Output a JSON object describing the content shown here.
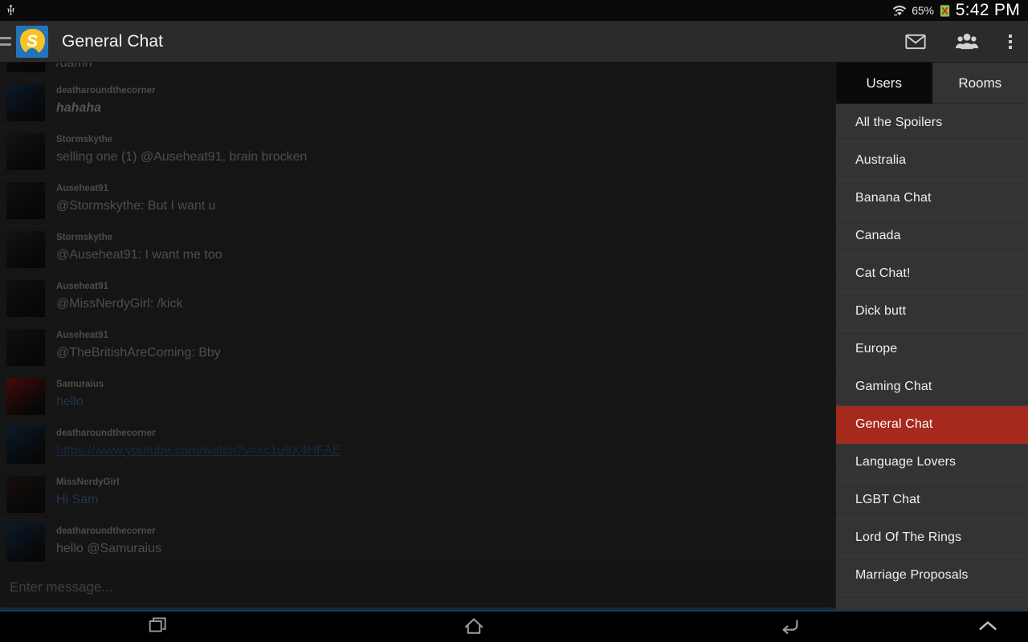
{
  "status_bar": {
    "usb_icon": "usb-icon",
    "wifi_icon": "wifi-icon",
    "battery_percent": "65%",
    "battery_icon": "battery-charging-icon",
    "time": "5:42 PM"
  },
  "action_bar": {
    "menu_icon": "hamburger-icon",
    "app_logo": "app-logo-s",
    "logo_letter": "S",
    "title": "General Chat",
    "actions": [
      {
        "name": "mail-icon",
        "label": "Mail"
      },
      {
        "name": "people-icon",
        "label": "Users"
      },
      {
        "name": "overflow-menu-icon",
        "label": "More options"
      }
    ]
  },
  "chat": {
    "messages": [
      {
        "user": "",
        "text": "/damn",
        "style": "plain",
        "clipped": true,
        "avatar": "#1c1c1c"
      },
      {
        "user": "deatharoundthecorner",
        "text": "hahaha",
        "style": "italic",
        "avatar": "#14304e"
      },
      {
        "user": "Stormskythe",
        "text": "selling one (1) @Auseheat91, brain brocken",
        "style": "plain",
        "avatar": "#2a2320"
      },
      {
        "user": "Auseheat91",
        "text": "@Stormskythe: But I want u",
        "style": "plain",
        "avatar": "#241d1a"
      },
      {
        "user": "Stormskythe",
        "text": "@Auseheat91: I want me too",
        "style": "plain",
        "avatar": "#2a2320"
      },
      {
        "user": "Auseheat91",
        "text": "@MissNerdyGirl: /kick",
        "style": "plain",
        "avatar": "#241d1a"
      },
      {
        "user": "Auseheat91",
        "text": "@TheBritishAreComing: Bby",
        "style": "plain",
        "avatar": "#241d1a"
      },
      {
        "user": "Samuraius",
        "text": "hello",
        "style": "blue",
        "avatar": "#7a1410"
      },
      {
        "user": "deatharoundthecorner",
        "text": "https://www.youtube.com/watch?v=xc1u9X4HFAE",
        "style": "link",
        "avatar": "#14304e"
      },
      {
        "user": "MissNerdyGirl",
        "text": "Hi Sam",
        "style": "blue",
        "avatar": "#2b1c18"
      },
      {
        "user": "deatharoundthecorner",
        "text": "hello @Samuraius",
        "style": "plain",
        "highlight": true,
        "avatar": "#14304e"
      }
    ],
    "composer_placeholder": "Enter message..."
  },
  "drawer": {
    "tabs": [
      {
        "label": "Users",
        "active": true
      },
      {
        "label": "Rooms",
        "active": false
      }
    ],
    "rooms": [
      {
        "label": "All the Spoilers",
        "selected": false
      },
      {
        "label": "Australia",
        "selected": false
      },
      {
        "label": "Banana Chat",
        "selected": false
      },
      {
        "label": "Canada",
        "selected": false
      },
      {
        "label": "Cat Chat!",
        "selected": false
      },
      {
        "label": "Dick butt",
        "selected": false
      },
      {
        "label": "Europe",
        "selected": false
      },
      {
        "label": "Gaming Chat",
        "selected": false
      },
      {
        "label": "General Chat",
        "selected": true
      },
      {
        "label": "Language Lovers",
        "selected": false
      },
      {
        "label": "LGBT Chat",
        "selected": false
      },
      {
        "label": "Lord Of The Rings",
        "selected": false
      },
      {
        "label": "Marriage Proposals",
        "selected": false
      }
    ]
  },
  "nav_bar": {
    "buttons": [
      {
        "name": "recents-icon",
        "label": "Recent apps"
      },
      {
        "name": "home-icon",
        "label": "Home"
      },
      {
        "name": "back-icon",
        "label": "Back"
      },
      {
        "name": "expand-up-icon",
        "label": "Expand"
      }
    ]
  },
  "colors": {
    "accent_red": "#a5291c",
    "brand_blue": "#2574bb",
    "brand_yellow": "#f6c324",
    "link_blue": "#2a4a78"
  }
}
